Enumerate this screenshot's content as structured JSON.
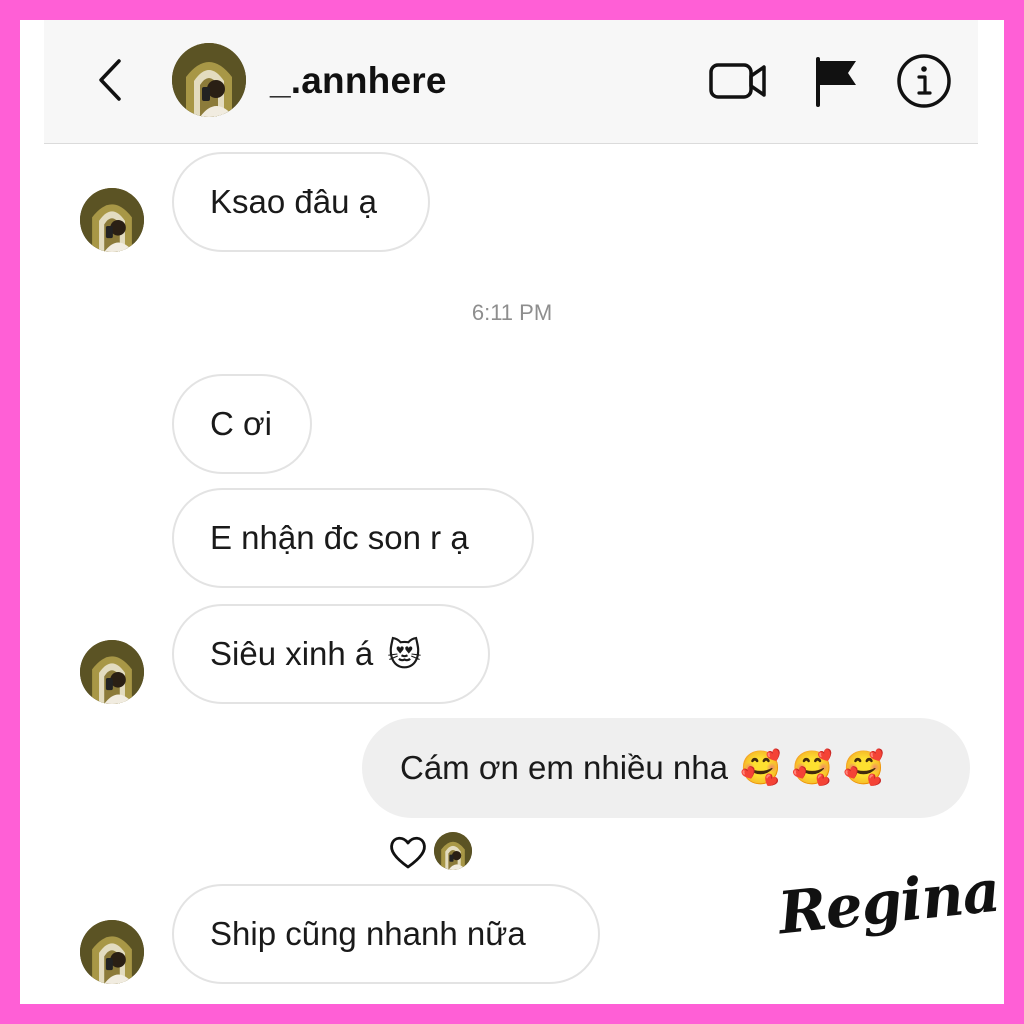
{
  "header": {
    "username": "_.annhere",
    "icons": [
      "back-chevron-icon",
      "video-call-icon",
      "flag-icon",
      "info-icon"
    ]
  },
  "messages": [
    {
      "direction": "incoming",
      "text": "Ksao đâu ạ",
      "show_avatar": true
    },
    {
      "direction": "incoming",
      "text": "C ơi",
      "show_avatar": false
    },
    {
      "direction": "incoming",
      "text": "E nhận đc son r ạ",
      "show_avatar": false
    },
    {
      "direction": "incoming",
      "text": "Siêu xinh á",
      "emoji": "😻",
      "show_avatar": true
    },
    {
      "direction": "outgoing",
      "text": "Cám ơn em nhiều nha",
      "emoji": "🥰 🥰 🥰",
      "reaction": "heart"
    },
    {
      "direction": "incoming",
      "text": "Ship cũng nhanh nữa",
      "show_avatar": true
    }
  ],
  "timestamp": "6:11 PM",
  "watermark": "Regina",
  "colors": {
    "border_frame": "#ff5fd6",
    "header_bg": "#f7f7f7",
    "incoming_bubble": "#ffffff",
    "outgoing_bubble": "#efefef",
    "timestamp_text": "#8e8e8e"
  }
}
